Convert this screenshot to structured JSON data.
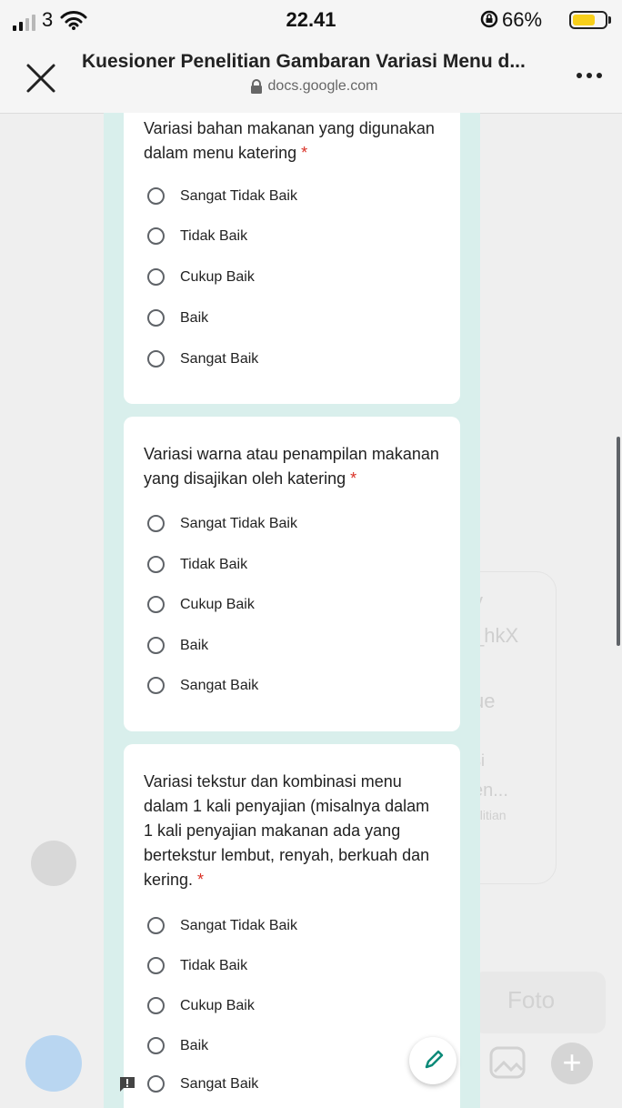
{
  "status_bar": {
    "carrier": "3",
    "time": "22.41",
    "battery_percent": "66%",
    "battery_color": "#f7cf1a"
  },
  "browser": {
    "title": "Kuesioner Penelitian Gambaran Variasi Menu d...",
    "url": "docs.google.com"
  },
  "background_app": {
    "fragments": [
      "y",
      "_hkX",
      "ue",
      "si",
      "en...",
      "elitian"
    ],
    "foto_label": "Foto"
  },
  "form": {
    "accent_color": "#d9efec",
    "required_color": "#d93025",
    "questions": [
      {
        "text": "Variasi bahan makanan yang digunakan dalam menu katering",
        "required_mark": "*",
        "options": [
          "Sangat Tidak Baik",
          "Tidak Baik",
          "Cukup Baik",
          "Baik",
          "Sangat Baik"
        ]
      },
      {
        "text": "Variasi warna atau penampilan makanan yang disajikan oleh katering",
        "required_mark": "*",
        "options": [
          "Sangat Tidak Baik",
          "Tidak Baik",
          "Cukup Baik",
          "Baik",
          "Sangat Baik"
        ]
      },
      {
        "text": "Variasi tekstur dan kombinasi menu dalam 1 kali penyajian (misalnya dalam 1 kali penyajian makanan ada yang bertekstur lembut, renyah, berkuah dan kering.",
        "required_mark": "*",
        "options": [
          "Sangat Tidak Baik",
          "Tidak Baik",
          "Cukup Baik",
          "Baik",
          "Sangat Baik"
        ]
      }
    ]
  },
  "icons": [
    "close-icon",
    "lock-icon",
    "more-icon",
    "wifi-icon",
    "pencil-icon",
    "feedback-icon"
  ]
}
